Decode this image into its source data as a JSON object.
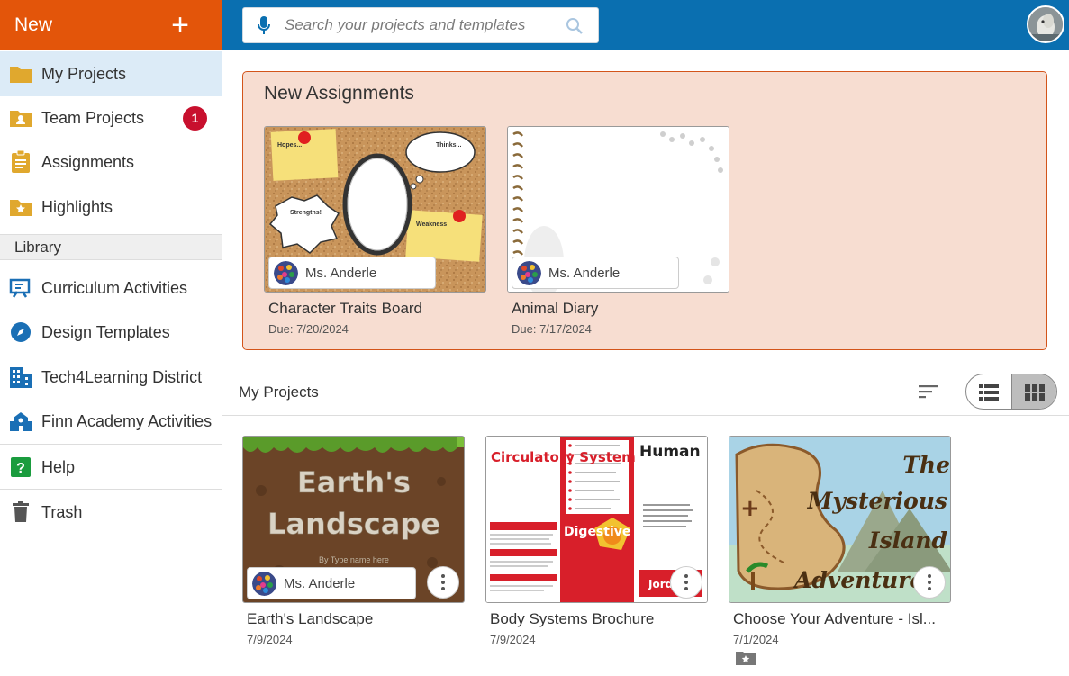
{
  "sidebar": {
    "new_label": "New",
    "new_icon": "plus-icon",
    "items": [
      {
        "label": "My Projects",
        "icon": "folder-icon"
      },
      {
        "label": "Team Projects",
        "icon": "team-folder-icon",
        "badge": "1"
      },
      {
        "label": "Assignments",
        "icon": "clipboard-icon"
      },
      {
        "label": "Highlights",
        "icon": "star-folder-icon"
      }
    ],
    "library_label": "Library",
    "library_items": [
      {
        "label": "Curriculum Activities",
        "icon": "curriculum-icon"
      },
      {
        "label": "Design Templates",
        "icon": "compass-icon"
      },
      {
        "label": "Tech4Learning District",
        "icon": "building-icon"
      },
      {
        "label": "Finn Academy Activities",
        "icon": "school-icon"
      }
    ],
    "help_label": "Help",
    "trash_label": "Trash"
  },
  "search": {
    "placeholder": "Search your projects and templates"
  },
  "assignments": {
    "heading": "New Assignments",
    "cards": [
      {
        "title": "Character Traits Board",
        "due": "Due: 7/20/2024",
        "owner": "Ms. Anderle"
      },
      {
        "title": "Animal Diary",
        "due": "Due: 7/17/2024",
        "owner": "Ms. Anderle"
      }
    ]
  },
  "projects": {
    "heading": "My Projects",
    "cards": [
      {
        "title": "Earth's Landscape",
        "date": "7/9/2024",
        "owner": "Ms. Anderle",
        "thumb_text": [
          "Earth's",
          "Landscape",
          "By Type name here"
        ]
      },
      {
        "title": "Body Systems Brochure",
        "date": "7/9/2024",
        "thumb_text": [
          "Circulatory System",
          "Human Body Systems",
          "Digestive System",
          "Jord"
        ]
      },
      {
        "title": "Choose Your Adventure - Isl...",
        "date": "7/1/2024",
        "thumb_text": [
          "The",
          "Mysterious",
          "Island",
          "Adventure"
        ]
      }
    ]
  },
  "thumb_labels": {
    "traits": [
      "Hopes...",
      "Thinks...",
      "Strengths!",
      "Weakness"
    ]
  },
  "colors": {
    "accent": "#e3550a",
    "topbar": "#0a6fb0",
    "assignments_bg": "#f7ddd1",
    "badge": "#c8102e"
  }
}
